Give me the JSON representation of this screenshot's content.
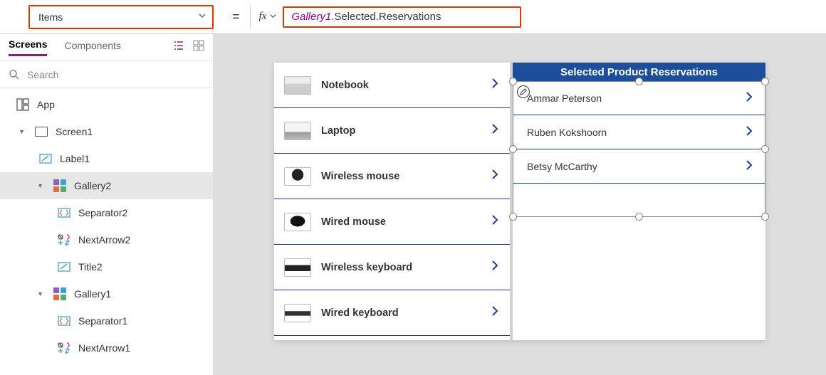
{
  "formulaBar": {
    "property": "Items",
    "fxLabel": "fx",
    "formulaPart1": "Gallery1",
    "formulaPart2": ".Selected.Reservations"
  },
  "panel": {
    "tabs": {
      "screens": "Screens",
      "components": "Components"
    },
    "searchPlaceholder": "Search",
    "tree": {
      "app": "App",
      "screen1": "Screen1",
      "label1": "Label1",
      "gallery2": "Gallery2",
      "separator2": "Separator2",
      "nextArrow2": "NextArrow2",
      "title2": "Title2",
      "gallery1": "Gallery1",
      "separator1": "Separator1",
      "nextArrow1": "NextArrow1"
    }
  },
  "gallery1": {
    "items": [
      {
        "label": "Notebook",
        "thumbClass": "thumb-notebook"
      },
      {
        "label": "Laptop",
        "thumbClass": "thumb-laptop"
      },
      {
        "label": "Wireless mouse",
        "thumbClass": "thumb-wmouse"
      },
      {
        "label": "Wired mouse",
        "thumbClass": "thumb-mouse"
      },
      {
        "label": "Wireless keyboard",
        "thumbClass": "thumb-wkey"
      },
      {
        "label": "Wired keyboard",
        "thumbClass": "thumb-key"
      }
    ]
  },
  "gallery2": {
    "header": "Selected Product Reservations",
    "items": [
      {
        "name": "Ammar Peterson"
      },
      {
        "name": "Ruben Kokshoorn"
      },
      {
        "name": "Betsy McCarthy"
      }
    ]
  }
}
